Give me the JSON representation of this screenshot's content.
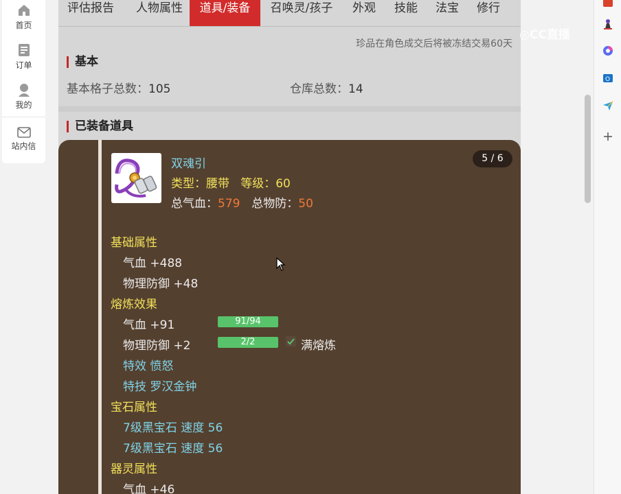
{
  "left_nav": {
    "items": [
      {
        "label": "首页",
        "icon": "home-icon"
      },
      {
        "label": "订单",
        "icon": "order-icon"
      },
      {
        "label": "我的",
        "icon": "user-icon"
      },
      {
        "label": "站内信",
        "icon": "mail-icon"
      }
    ]
  },
  "tabs": [
    {
      "label": "评估报告"
    },
    {
      "label": "人物属性"
    },
    {
      "label": "道具/装备",
      "active": true
    },
    {
      "label": "召唤灵/孩子"
    },
    {
      "label": "外观"
    },
    {
      "label": "技能"
    },
    {
      "label": "法宝"
    },
    {
      "label": "修行"
    }
  ],
  "notice": "珍品在角色成交后将被冻结交易60天",
  "basic": {
    "title": "基本",
    "slots_label": "基本格子总数：",
    "slots_value": "105",
    "warehouse_label": "仓库总数：",
    "warehouse_value": "14"
  },
  "equipped": {
    "title": "已装备道具"
  },
  "item": {
    "name": "双魂引",
    "page": "5 / 6",
    "type_line": "类型：腰带   等级：60",
    "total_hp_label": "总气血：",
    "total_hp_value": "579",
    "total_def_label": "总物防：",
    "total_def_value": "50",
    "base_title": "基础属性",
    "base_attrs": [
      "气血 +488",
      "物理防御 +48"
    ],
    "smelt_title": "熔炼效果",
    "smelt_attrs": [
      {
        "label": "气血 +91",
        "progress": "91/94",
        "fraction": 0.968
      },
      {
        "label": "物理防御 +2",
        "progress": "2/2",
        "fraction": 1.0,
        "status": "满熔炼"
      }
    ],
    "special_effect": "特效 愤怒",
    "special_skill": "特技 罗汉金钟",
    "gem_title": "宝石属性",
    "gems": [
      "7级黑宝石 速度 56",
      "7级黑宝石 速度 56"
    ],
    "spirit_title": "器灵属性",
    "spirit_attrs": [
      "气血 +46"
    ]
  },
  "watermark": "CC直播",
  "colors": {
    "accent_red": "#d12b2b",
    "card_bg": "#54402f",
    "attr_yellow": "#f0e05a",
    "attr_cyan": "#7fd3e8",
    "value_orange": "#f0793a",
    "bar_green": "#58c36a"
  }
}
